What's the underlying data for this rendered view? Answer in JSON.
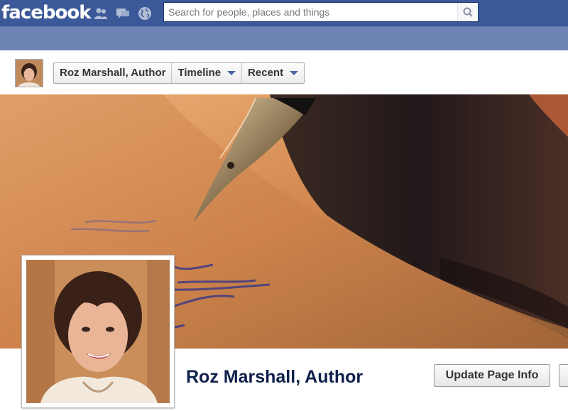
{
  "topbar": {
    "logo": "facebook",
    "icons": [
      "friend-requests-icon",
      "messages-icon",
      "notifications-globe-icon"
    ],
    "search_placeholder": "Search for people, places and things",
    "search_button_icon": "magnifier-icon"
  },
  "nav": {
    "crumbs": [
      {
        "label": "Roz Marshall, Author"
      },
      {
        "label": "Timeline"
      },
      {
        "label": "Recent"
      }
    ]
  },
  "page": {
    "name": "Roz Marshall, Author",
    "update_button": "Update Page Info"
  },
  "colors": {
    "brand_blue": "#3b5998",
    "bar_blue": "#6d84b4",
    "name_navy": "#0e1f4a"
  }
}
